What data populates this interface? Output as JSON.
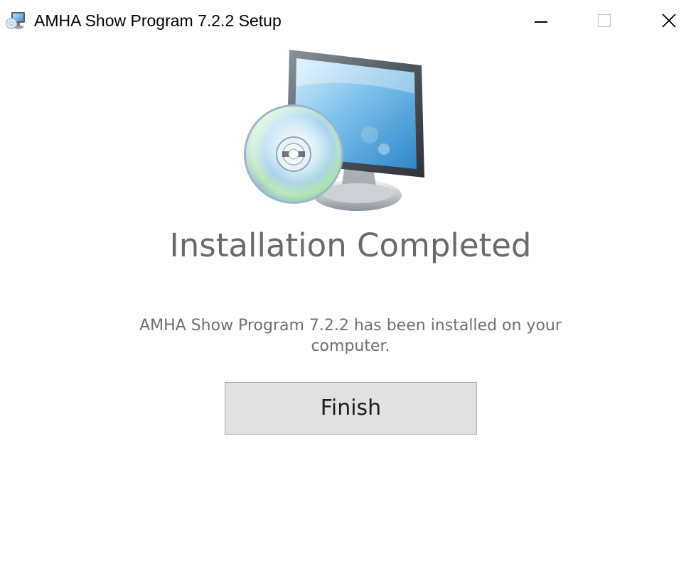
{
  "window": {
    "title": "AMHA Show Program 7.2.2 Setup",
    "icon": "setup-monitor-icon",
    "controls": {
      "minimize": "minimize-icon",
      "maximize": "maximize-icon",
      "close": "close-icon"
    }
  },
  "content": {
    "illustration": "monitor-with-cd-icon",
    "heading": "Installation Completed",
    "message": "AMHA Show Program 7.2.2 has been installed on your computer.",
    "finish_label": "Finish"
  },
  "colors": {
    "heading_text": "#6a6a6a",
    "message_text": "#707070",
    "button_face": "#e1e1e1",
    "button_border": "#adadad",
    "background": "#ffffff"
  }
}
